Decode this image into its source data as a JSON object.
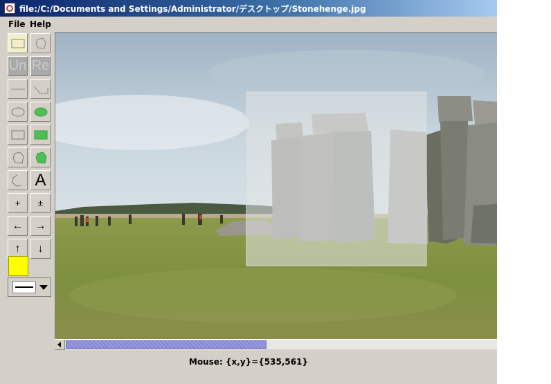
{
  "window": {
    "title": "file:/C:/Documents and Settings/Administrator/デスクトップ/Stonehenge.jpg",
    "app_icon": "java-cup-icon"
  },
  "menu": {
    "items": [
      "File",
      "Help"
    ]
  },
  "toolbar": {
    "undo_label": "Un",
    "redo_label": "Re",
    "text_tool_label": "A",
    "zoom_in_label": "+",
    "zoom_plusminus_label": "±",
    "left_label": "←",
    "right_label": "→",
    "up_label": "↑",
    "down_label": "↓",
    "current_color": "#ffff00"
  },
  "status": {
    "mouse": "Mouse: {x,y}={535,561}"
  },
  "scrollbar": {
    "position_fraction": 0.0,
    "visible_fraction": 0.47
  }
}
